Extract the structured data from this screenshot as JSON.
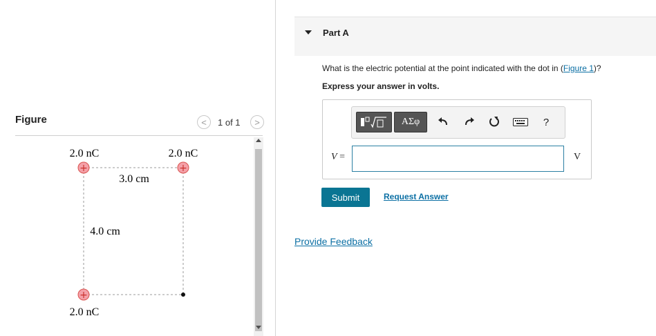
{
  "figure_panel": {
    "title": "Figure",
    "pager": "1 of 1",
    "prev_symbol": "<",
    "next_symbol": ">",
    "charges": [
      "2.0 nC",
      "2.0 nC",
      "2.0 nC"
    ],
    "charge_sign": "+",
    "dimension_horizontal": "3.0 cm",
    "dimension_vertical": "4.0 cm"
  },
  "part": {
    "title": "Part A",
    "question_prefix": "What is the electric potential at the point indicated with the dot in (",
    "figure_link": "Figure 1",
    "question_suffix": ")?",
    "instruction": "Express your answer in volts."
  },
  "answer": {
    "variable": "V",
    "equals": "=",
    "value": "",
    "unit": "V",
    "submit_label": "Submit",
    "request_label": "Request Answer"
  },
  "toolbar": {
    "symbols_label": "ΑΣφ",
    "help_label": "?",
    "icons": [
      "templates-icon",
      "greek-symbols-icon",
      "undo-icon",
      "redo-icon",
      "reset-icon",
      "keyboard-icon",
      "help-icon"
    ]
  },
  "feedback_label": "Provide Feedback"
}
